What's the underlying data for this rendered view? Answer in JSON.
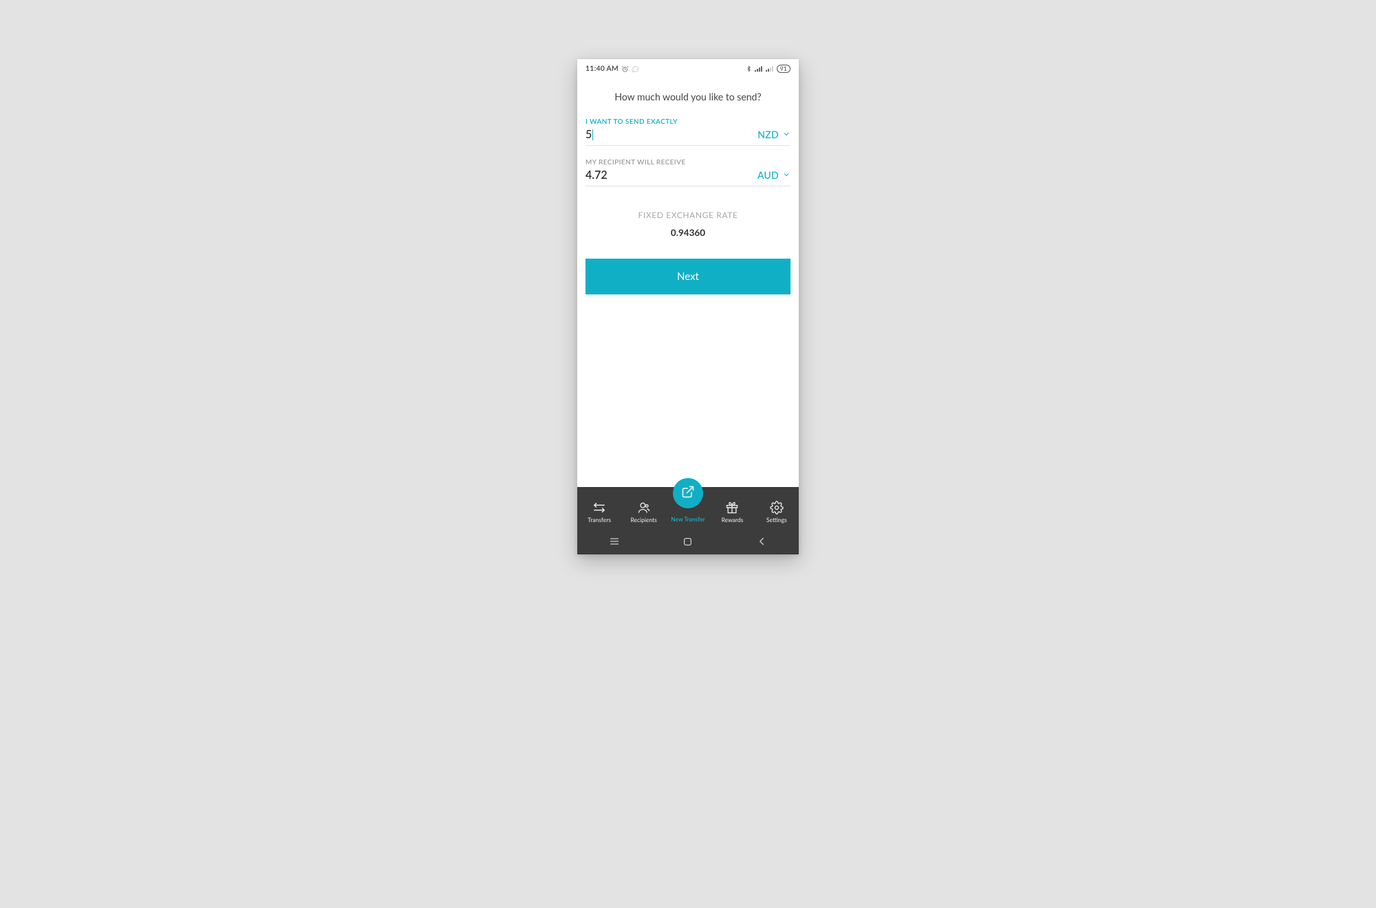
{
  "status": {
    "time": "11:40 AM",
    "battery": "91"
  },
  "page": {
    "title": "How much would you like to send?"
  },
  "send": {
    "label": "I WANT TO SEND EXACTLY",
    "value": "5",
    "currency": "NZD"
  },
  "receive": {
    "label": "MY RECIPIENT WILL RECEIVE",
    "value": "4.72",
    "currency": "AUD"
  },
  "rate": {
    "label": "FIXED EXCHANGE RATE",
    "value": "0.94360"
  },
  "actions": {
    "next": "Next"
  },
  "nav": {
    "transfers": "Transfers",
    "recipients": "Recipients",
    "new_transfer": "New Transfer",
    "rewards": "Rewards",
    "settings": "Settings"
  }
}
